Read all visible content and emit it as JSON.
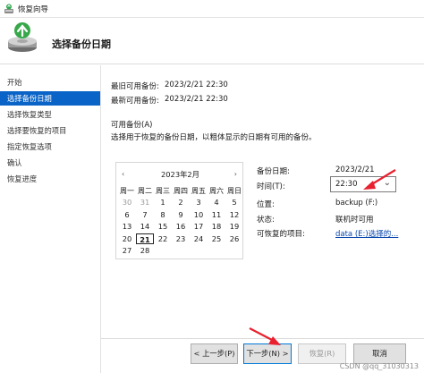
{
  "window": {
    "title": "恢复向导"
  },
  "header": {
    "heading": "选择备份日期"
  },
  "nav": {
    "items": [
      {
        "label": "开始",
        "active": false
      },
      {
        "label": "选择备份日期",
        "active": true
      },
      {
        "label": "选择恢复类型",
        "active": false
      },
      {
        "label": "选择要恢复的项目",
        "active": false
      },
      {
        "label": "指定恢复选项",
        "active": false
      },
      {
        "label": "确认",
        "active": false
      },
      {
        "label": "恢复进度",
        "active": false
      }
    ]
  },
  "summary": {
    "oldest_label": "最旧可用备份:",
    "oldest_value": "2023/2/21 22:30",
    "newest_label": "最新可用备份:",
    "newest_value": "2023/2/21 22:30"
  },
  "available": {
    "section_label": "可用备份(A)",
    "instruction": "选择用于恢复的备份日期，以粗体显示的日期有可用的备份。"
  },
  "calendar": {
    "prev": "‹",
    "next": "›",
    "month": "2023年2月",
    "weekdays": [
      "周一",
      "周二",
      "周三",
      "周四",
      "周五",
      "周六",
      "周日"
    ],
    "weeks": [
      [
        "30",
        "31",
        "1",
        "2",
        "3",
        "4",
        "5"
      ],
      [
        "6",
        "7",
        "8",
        "9",
        "10",
        "11",
        "12"
      ],
      [
        "13",
        "14",
        "15",
        "16",
        "17",
        "18",
        "19"
      ],
      [
        "20",
        "21",
        "22",
        "23",
        "24",
        "25",
        "26"
      ],
      [
        "27",
        "28",
        "",
        "",
        "",
        "",
        ""
      ]
    ],
    "selected_day": "21"
  },
  "details": {
    "date_label": "备份日期:",
    "date_value": "2023/2/21",
    "time_label": "时间(T):",
    "time_value": "22:30",
    "location_label": "位置:",
    "location_value": "backup (F:)",
    "status_label": "状态:",
    "status_value": "联机时可用",
    "items_label": "可恢复的项目:",
    "items_link": "data (E:)选择的..."
  },
  "buttons": {
    "back": "< 上一步(P)",
    "next": "下一步(N) >",
    "recover": "恢复(R)",
    "cancel": "取消"
  },
  "watermark": "CSDN @qq_31030313",
  "colors": {
    "accent": "#0a64c8",
    "annotation": "#e8202f",
    "link": "#0645ad"
  }
}
